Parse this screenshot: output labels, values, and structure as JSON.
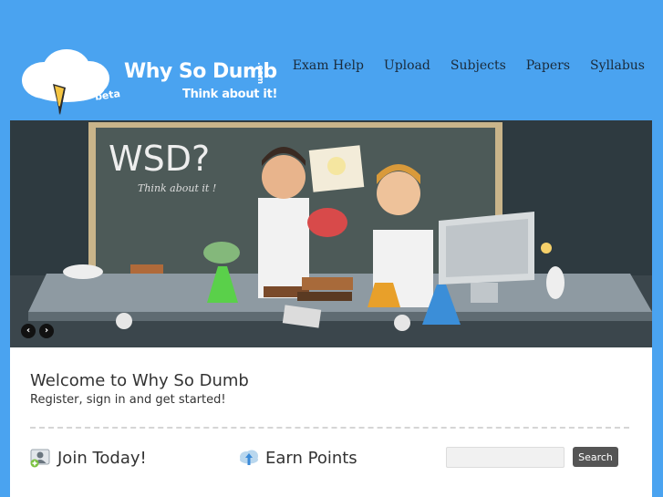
{
  "brand": {
    "title": "Why So Dumb",
    "com": ".com",
    "tagline": "Think about it!",
    "beta": "beta"
  },
  "nav": {
    "items": [
      "Exam Help",
      "Upload",
      "Subjects",
      "Papers",
      "Syllabus"
    ]
  },
  "banner": {
    "chalk_title": "WSD?",
    "chalk_sub": "Think about it !"
  },
  "slider": {
    "prev": "‹",
    "next": "›"
  },
  "welcome": {
    "title": "Welcome to Why So Dumb",
    "subtitle": "Register, sign in and get started!"
  },
  "features": [
    {
      "label": "Join Today!",
      "icon": "user-add-icon"
    },
    {
      "label": "Earn Points",
      "icon": "cloud-upload-icon"
    }
  ],
  "search": {
    "button": "Search",
    "value": ""
  },
  "colors": {
    "background": "#4aa3f0",
    "nav_text": "#1a2a3a",
    "button": "#555555"
  }
}
